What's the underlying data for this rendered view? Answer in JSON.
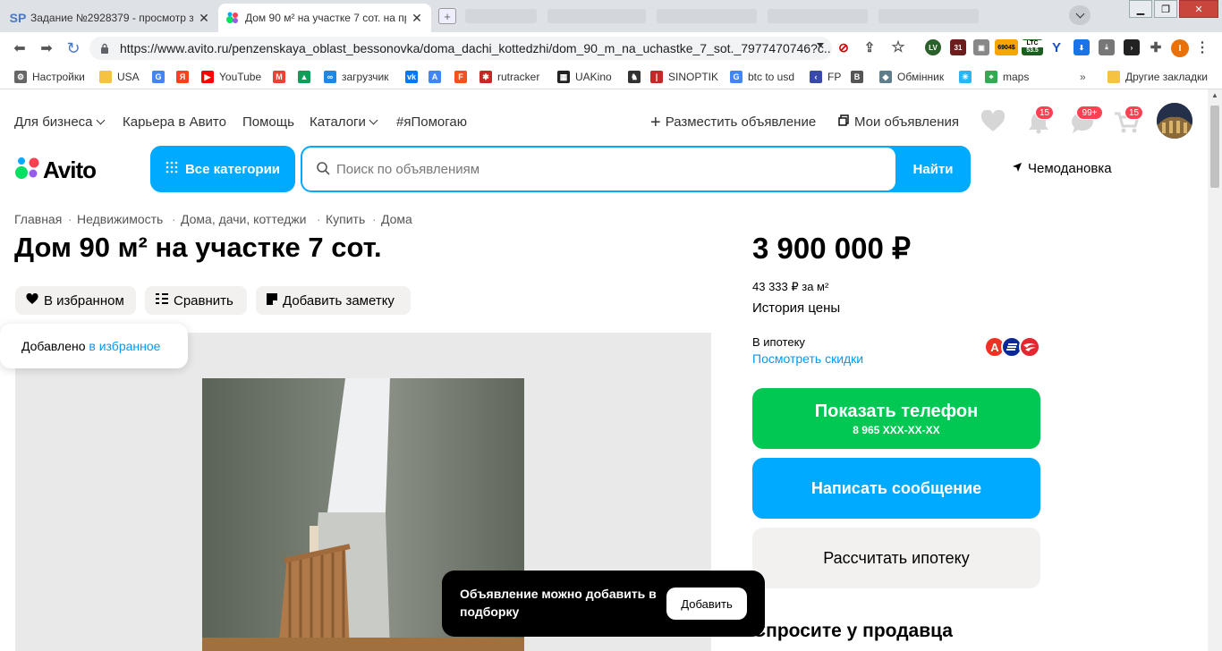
{
  "browser": {
    "tabs": [
      {
        "favicon": "SP",
        "title": "Задание №2928379 - просмотр з"
      },
      {
        "favicon": "avito",
        "title": "Дом 90 м² на участке 7 сот. на пр"
      }
    ],
    "url": "https://www.avito.ru/penzenskaya_oblast_bessonovka/doma_dachi_kottedzhi/dom_90_m_na_uchastke_7_sot._7977470746?c...",
    "extensions": {
      "ltc_label": "LTC",
      "ltc_value": "53.5",
      "counter": "6904$",
      "calendar": "31",
      "lv": "LV"
    },
    "bookmarks": [
      {
        "icon": "gear-icon",
        "label": "Настройки"
      },
      {
        "icon": "folder-icon",
        "label": "USA"
      },
      {
        "icon": "google-icon",
        "label": ""
      },
      {
        "icon": "yandex-icon",
        "label": ""
      },
      {
        "icon": "youtube-icon",
        "label": "YouTube"
      },
      {
        "icon": "gmail-icon",
        "label": ""
      },
      {
        "icon": "drive-icon",
        "label": ""
      },
      {
        "icon": "infinity-icon",
        "label": "загрузчик"
      },
      {
        "icon": "vk-icon",
        "label": ""
      },
      {
        "icon": "translate-icon",
        "label": ""
      },
      {
        "icon": "f-icon",
        "label": ""
      },
      {
        "icon": "rutracker-icon",
        "label": "rutracker"
      },
      {
        "icon": "uakino-icon",
        "label": "UAKino"
      },
      {
        "icon": "chess-icon",
        "label": ""
      },
      {
        "icon": "thermometer-icon",
        "label": "SINOPTIK"
      },
      {
        "icon": "google-icon",
        "label": "btc to usd"
      },
      {
        "icon": "fp-icon",
        "label": "FP"
      },
      {
        "icon": "bc-icon",
        "label": ""
      },
      {
        "icon": "exchange-icon",
        "label": "Обмінник"
      },
      {
        "icon": "snowflake-icon",
        "label": ""
      },
      {
        "icon": "maps-icon",
        "label": "maps"
      }
    ],
    "more_bookmarks": "»",
    "other_bookmarks": "Другие закладки"
  },
  "header": {
    "nav": [
      {
        "label": "Для бизнеса",
        "dropdown": true
      },
      {
        "label": "Карьера в Авито",
        "dropdown": false
      },
      {
        "label": "Помощь",
        "dropdown": false
      },
      {
        "label": "Каталоги",
        "dropdown": true
      },
      {
        "label": "#яПомогаю",
        "dropdown": false
      }
    ],
    "post_ad": "Разместить объявление",
    "my_ads": "Мои объявления",
    "badges": {
      "notifications": "15",
      "messages": "99+",
      "cart": "15"
    },
    "logo": "Avito",
    "all_categories": "Все категории",
    "search_placeholder": "Поиск по объявлениям",
    "search_button": "Найти",
    "location": "Чемодановка"
  },
  "breadcrumbs": [
    "Главная",
    "Недвижимость",
    "Дома, дачи, коттеджи",
    "Купить",
    "Дома"
  ],
  "breadcrumb_sep": "·",
  "listing": {
    "title": "Дом 90 м² на участке 7 сот.",
    "favorite_label": "В избранном",
    "compare_label": "Сравнить",
    "note_label": "Добавить заметку",
    "tooltip_prefix": "Добавлено",
    "tooltip_link": "в избранное"
  },
  "sidebar": {
    "price": "3 900 000 ₽",
    "price_per_m2": "43 333 ₽ за м²",
    "price_history": "История цены",
    "mortgage_label": "В ипотеку",
    "mortgage_link": "Посмотреть скидки",
    "show_phone": "Показать телефон",
    "phone_masked": "8 965 XXX-XX-XX",
    "write_message": "Написать сообщение",
    "calc_mortgage": "Рассчитать ипотеку",
    "ask_seller": "Спросите у продавца"
  },
  "toast": {
    "text": "Объявление можно добавить в подборку",
    "button": "Добавить"
  },
  "colors": {
    "accent": "#00aaff",
    "green": "#00c853",
    "badge": "#ff4053",
    "link": "#0099f7"
  }
}
